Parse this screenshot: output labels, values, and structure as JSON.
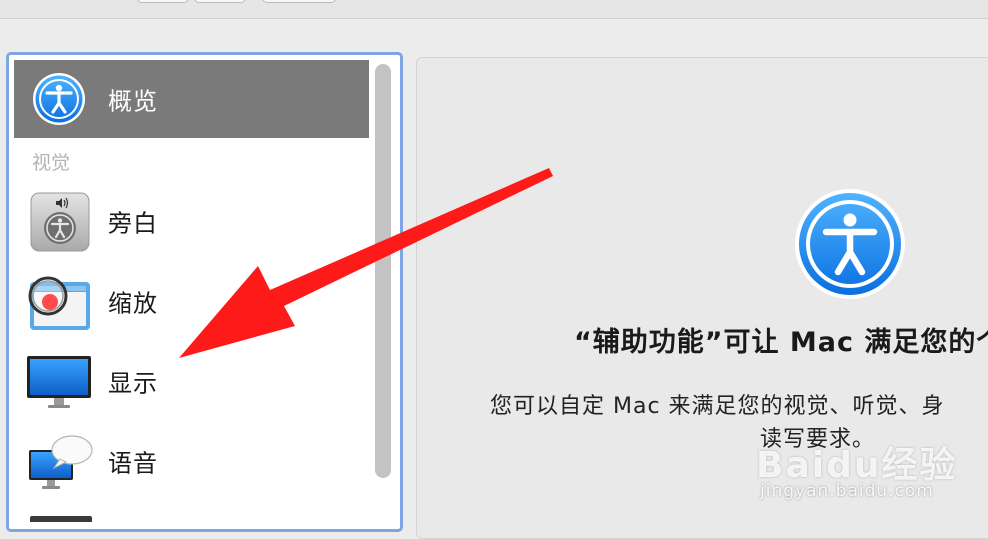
{
  "sidebar": {
    "items": [
      {
        "label": "概览",
        "icon": "accessibility-icon",
        "selected": true
      },
      {
        "label": "旁白",
        "icon": "voiceover-icon",
        "selected": false
      },
      {
        "label": "缩放",
        "icon": "zoom-icon",
        "selected": false
      },
      {
        "label": "显示",
        "icon": "display-icon",
        "selected": false
      },
      {
        "label": "语音",
        "icon": "speech-icon",
        "selected": false
      }
    ],
    "section_heading": "视觉"
  },
  "overview": {
    "title": "“辅助功能”可让 Mac 满足您的个",
    "description_line1": "您可以自定 Mac 来满足您的视觉、听觉、身",
    "description_line2": "读写要求。"
  },
  "watermark": {
    "logo": "Baidu经验",
    "url": "jingyan.baidu.com"
  },
  "colors": {
    "accent_blue": "#1a8cff",
    "selection_gray": "#7a7a7a",
    "focus_ring": "#7fa6e3",
    "annotation_red": "#ff1a1a"
  }
}
